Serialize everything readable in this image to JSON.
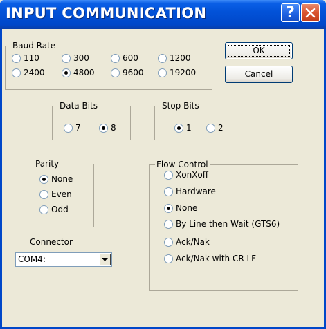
{
  "window": {
    "title": "INPUT COMMUNICATION",
    "help_glyph": "?",
    "icons": {
      "help": "help-icon",
      "close": "close-icon"
    }
  },
  "baud_rate": {
    "label": "Baud Rate",
    "options": [
      "110",
      "300",
      "600",
      "1200",
      "2400",
      "4800",
      "9600",
      "19200"
    ],
    "selected": "4800"
  },
  "data_bits": {
    "label": "Data Bits",
    "options": [
      "7",
      "8"
    ],
    "selected": "8"
  },
  "stop_bits": {
    "label": "Stop Bits",
    "options": [
      "1",
      "2"
    ],
    "selected": "1"
  },
  "parity": {
    "label": "Parity",
    "options": [
      "None",
      "Even",
      "Odd"
    ],
    "selected": "None"
  },
  "flow_control": {
    "label": "Flow Control",
    "options": [
      "XonXoff",
      "Hardware",
      "None",
      "By Line then Wait (GTS6)",
      "Ack/Nak",
      "Ack/Nak with CR LF"
    ],
    "selected": "None"
  },
  "connector": {
    "label": "Connector",
    "value": "COM4:"
  },
  "buttons": {
    "ok": "OK",
    "cancel": "Cancel"
  },
  "colors": {
    "titlebar": "#0047c9",
    "dialog_bg": "#ece9d8",
    "close_button": "#d9532e"
  }
}
